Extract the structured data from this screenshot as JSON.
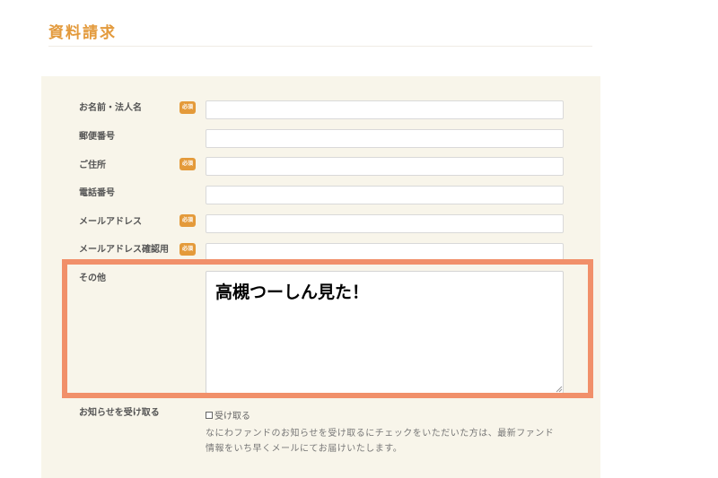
{
  "page": {
    "title": "資料請求"
  },
  "form": {
    "required_label": "必須",
    "fields": [
      {
        "label": "お名前・法人名",
        "value": ""
      },
      {
        "label": "郵便番号",
        "value": ""
      },
      {
        "label": "ご住所",
        "value": ""
      },
      {
        "label": "電話番号",
        "value": ""
      },
      {
        "label": "メールアドレス",
        "value": ""
      },
      {
        "label": "メールアドレス確認用",
        "value": ""
      }
    ],
    "other": {
      "label": "その他",
      "value": "高槻つーしん見た！"
    },
    "newsletter": {
      "label": "お知らせを受け取る",
      "checkbox_label": "受け取る",
      "checked": false,
      "notice_line1": "なにわファンドのお知らせを受け取るにチェックをいただいた方は、最新ファンド",
      "notice_line2": "情報をいち早くメールにてお届けいたします。"
    }
  },
  "colors": {
    "accent": "#e39a3c",
    "panel_bg": "#f8f5ea",
    "highlight": "#f1906a"
  }
}
